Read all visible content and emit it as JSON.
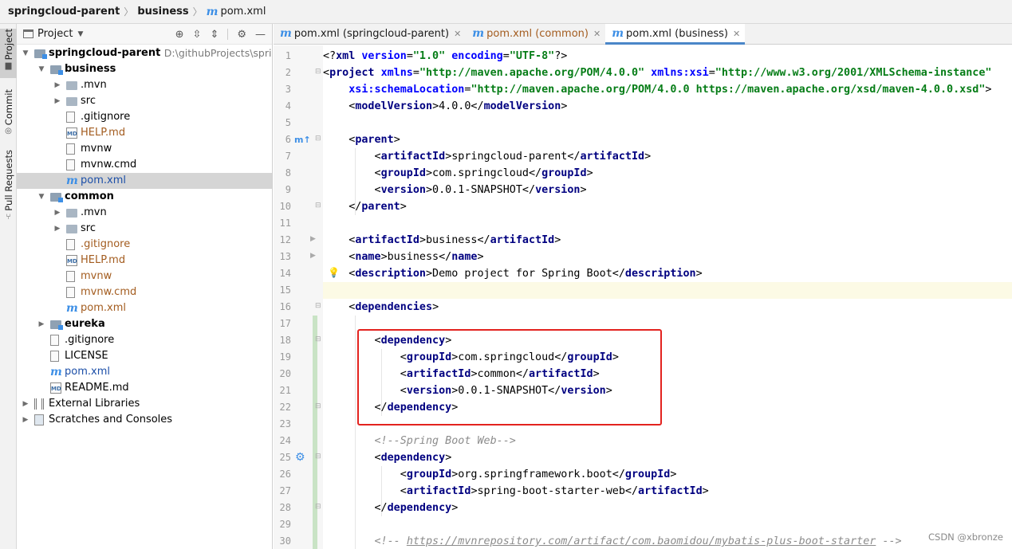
{
  "breadcrumb": {
    "items": [
      "springcloud-parent",
      "business"
    ],
    "file": "pom.xml"
  },
  "tool_strip": {
    "items": [
      "Project",
      "Commit",
      "Pull Requests"
    ]
  },
  "project_panel": {
    "title": "Project",
    "tree": [
      {
        "label": "springcloud-parent",
        "path": "D:\\githubProjects\\springclo",
        "depth": 0,
        "expand": "open",
        "icon": "module-folder",
        "style": "bold"
      },
      {
        "label": "business",
        "depth": 1,
        "expand": "open",
        "icon": "module-folder",
        "style": "bold"
      },
      {
        "label": ".mvn",
        "depth": 2,
        "expand": "closed",
        "icon": "folder"
      },
      {
        "label": "src",
        "depth": 2,
        "expand": "closed",
        "icon": "folder"
      },
      {
        "label": ".gitignore",
        "depth": 2,
        "icon": "ignore-file"
      },
      {
        "label": "HELP.md",
        "depth": 2,
        "icon": "md-file",
        "style": "brown"
      },
      {
        "label": "mvnw",
        "depth": 2,
        "icon": "file"
      },
      {
        "label": "mvnw.cmd",
        "depth": 2,
        "icon": "file"
      },
      {
        "label": "pom.xml",
        "depth": 2,
        "icon": "maven-file",
        "style": "blue",
        "selected": true
      },
      {
        "label": "common",
        "depth": 1,
        "expand": "open",
        "icon": "module-folder",
        "style": "bold"
      },
      {
        "label": ".mvn",
        "depth": 2,
        "expand": "closed",
        "icon": "folder"
      },
      {
        "label": "src",
        "depth": 2,
        "expand": "closed",
        "icon": "folder"
      },
      {
        "label": ".gitignore",
        "depth": 2,
        "icon": "ignore-file",
        "style": "brown"
      },
      {
        "label": "HELP.md",
        "depth": 2,
        "icon": "md-file",
        "style": "brown"
      },
      {
        "label": "mvnw",
        "depth": 2,
        "icon": "file",
        "style": "brown"
      },
      {
        "label": "mvnw.cmd",
        "depth": 2,
        "icon": "file",
        "style": "brown"
      },
      {
        "label": "pom.xml",
        "depth": 2,
        "icon": "maven-file",
        "style": "brown"
      },
      {
        "label": "eureka",
        "depth": 1,
        "expand": "closed",
        "icon": "module-folder",
        "style": "bold"
      },
      {
        "label": ".gitignore",
        "depth": 1,
        "icon": "ignore-file"
      },
      {
        "label": "LICENSE",
        "depth": 1,
        "icon": "file"
      },
      {
        "label": "pom.xml",
        "depth": 1,
        "icon": "maven-file",
        "style": "blue"
      },
      {
        "label": "README.md",
        "depth": 1,
        "icon": "md-file"
      },
      {
        "label": "External Libraries",
        "depth": 0,
        "expand": "closed",
        "icon": "library"
      },
      {
        "label": "Scratches and Consoles",
        "depth": 0,
        "expand": "closed",
        "icon": "scratches"
      }
    ]
  },
  "editor": {
    "tabs": [
      {
        "label": "pom.xml (springcloud-parent)",
        "active": false,
        "style": "normal"
      },
      {
        "label": "pom.xml (common)",
        "active": false,
        "style": "brown"
      },
      {
        "label": "pom.xml (business)",
        "active": true,
        "style": "normal"
      }
    ],
    "current_line": 15,
    "lines": [
      {
        "n": 1,
        "t": [
          [
            "x",
            "<?"
          ],
          [
            "tg",
            "xml "
          ],
          [
            "an",
            "version"
          ],
          [
            "x",
            "="
          ],
          [
            "av",
            "\"1.0\""
          ],
          [
            "x",
            " "
          ],
          [
            "an",
            "encoding"
          ],
          [
            "x",
            "="
          ],
          [
            "av",
            "\"UTF-8\""
          ],
          [
            "x",
            "?>"
          ]
        ]
      },
      {
        "n": 2,
        "t": [
          [
            "x",
            "<"
          ],
          [
            "tg",
            "project "
          ],
          [
            "an",
            "xmlns"
          ],
          [
            "x",
            "="
          ],
          [
            "av",
            "\"http://maven.apache.org/POM/4.0.0\""
          ],
          [
            "x",
            " "
          ],
          [
            "an",
            "xmlns:xsi"
          ],
          [
            "x",
            "="
          ],
          [
            "av",
            "\"http://www.w3.org/2001/XMLSchema-instance\""
          ]
        ]
      },
      {
        "n": 3,
        "t": [
          [
            "x",
            "    "
          ],
          [
            "an",
            "xsi:schemaLocation"
          ],
          [
            "x",
            "="
          ],
          [
            "av",
            "\"http://maven.apache.org/POM/4.0.0 https://maven.apache.org/xsd/maven-4.0.0.xsd\""
          ],
          [
            "x",
            ">"
          ]
        ]
      },
      {
        "n": 4,
        "t": [
          [
            "x",
            "    <"
          ],
          [
            "tg",
            "modelVersion"
          ],
          [
            "x",
            ">4.0.0</"
          ],
          [
            "tg",
            "modelVersion"
          ],
          [
            "x",
            ">"
          ]
        ]
      },
      {
        "n": 5,
        "t": []
      },
      {
        "n": 6,
        "t": [
          [
            "x",
            "    <"
          ],
          [
            "tg",
            "parent"
          ],
          [
            "x",
            ">"
          ]
        ]
      },
      {
        "n": 7,
        "t": [
          [
            "x",
            "        <"
          ],
          [
            "tg",
            "artifactId"
          ],
          [
            "x",
            ">springcloud-parent</"
          ],
          [
            "tg",
            "artifactId"
          ],
          [
            "x",
            ">"
          ]
        ]
      },
      {
        "n": 8,
        "t": [
          [
            "x",
            "        <"
          ],
          [
            "tg",
            "groupId"
          ],
          [
            "x",
            ">com.springcloud</"
          ],
          [
            "tg",
            "groupId"
          ],
          [
            "x",
            ">"
          ]
        ]
      },
      {
        "n": 9,
        "t": [
          [
            "x",
            "        <"
          ],
          [
            "tg",
            "version"
          ],
          [
            "x",
            ">0.0.1-SNAPSHOT</"
          ],
          [
            "tg",
            "version"
          ],
          [
            "x",
            ">"
          ]
        ]
      },
      {
        "n": 10,
        "t": [
          [
            "x",
            "    </"
          ],
          [
            "tg",
            "parent"
          ],
          [
            "x",
            ">"
          ]
        ]
      },
      {
        "n": 11,
        "t": []
      },
      {
        "n": 12,
        "t": [
          [
            "x",
            "    <"
          ],
          [
            "tg",
            "artifactId"
          ],
          [
            "x",
            ">business</"
          ],
          [
            "tg",
            "artifactId"
          ],
          [
            "x",
            ">"
          ]
        ]
      },
      {
        "n": 13,
        "t": [
          [
            "x",
            "    <"
          ],
          [
            "tg",
            "name"
          ],
          [
            "x",
            ">business</"
          ],
          [
            "tg",
            "name"
          ],
          [
            "x",
            ">"
          ]
        ]
      },
      {
        "n": 14,
        "t": [
          [
            "x",
            "    <"
          ],
          [
            "tg",
            "description"
          ],
          [
            "x",
            ">Demo project for Spring Boot</"
          ],
          [
            "tg",
            "description"
          ],
          [
            "x",
            ">"
          ]
        ]
      },
      {
        "n": 15,
        "t": []
      },
      {
        "n": 16,
        "t": [
          [
            "x",
            "    <"
          ],
          [
            "tg",
            "dependencies"
          ],
          [
            "x",
            ">"
          ]
        ]
      },
      {
        "n": 17,
        "t": []
      },
      {
        "n": 18,
        "t": [
          [
            "x",
            "        <"
          ],
          [
            "tg",
            "dependency"
          ],
          [
            "x",
            ">"
          ]
        ]
      },
      {
        "n": 19,
        "t": [
          [
            "x",
            "            <"
          ],
          [
            "tg",
            "groupId"
          ],
          [
            "x",
            ">com.springcloud</"
          ],
          [
            "tg",
            "groupId"
          ],
          [
            "x",
            ">"
          ]
        ]
      },
      {
        "n": 20,
        "t": [
          [
            "x",
            "            <"
          ],
          [
            "tg",
            "artifactId"
          ],
          [
            "x",
            ">common</"
          ],
          [
            "tg",
            "artifactId"
          ],
          [
            "x",
            ">"
          ]
        ]
      },
      {
        "n": 21,
        "t": [
          [
            "x",
            "            <"
          ],
          [
            "tg",
            "version"
          ],
          [
            "x",
            ">0.0.1-SNAPSHOT</"
          ],
          [
            "tg",
            "version"
          ],
          [
            "x",
            ">"
          ]
        ]
      },
      {
        "n": 22,
        "t": [
          [
            "x",
            "        </"
          ],
          [
            "tg",
            "dependency"
          ],
          [
            "x",
            ">"
          ]
        ]
      },
      {
        "n": 23,
        "t": []
      },
      {
        "n": 24,
        "t": [
          [
            "x",
            "        "
          ],
          [
            "cm",
            "<!--Spring Boot Web-->"
          ]
        ]
      },
      {
        "n": 25,
        "t": [
          [
            "x",
            "        <"
          ],
          [
            "tg",
            "dependency"
          ],
          [
            "x",
            ">"
          ]
        ]
      },
      {
        "n": 26,
        "t": [
          [
            "x",
            "            <"
          ],
          [
            "tg",
            "groupId"
          ],
          [
            "x",
            ">org.springframework.boot</"
          ],
          [
            "tg",
            "groupId"
          ],
          [
            "x",
            ">"
          ]
        ]
      },
      {
        "n": 27,
        "t": [
          [
            "x",
            "            <"
          ],
          [
            "tg",
            "artifactId"
          ],
          [
            "x",
            ">spring-boot-starter-web</"
          ],
          [
            "tg",
            "artifactId"
          ],
          [
            "x",
            ">"
          ]
        ]
      },
      {
        "n": 28,
        "t": [
          [
            "x",
            "        </"
          ],
          [
            "tg",
            "dependency"
          ],
          [
            "x",
            ">"
          ]
        ]
      },
      {
        "n": 29,
        "t": []
      },
      {
        "n": 30,
        "t": [
          [
            "x",
            "        "
          ],
          [
            "cm",
            "<!-- "
          ],
          [
            "url",
            "https://mvnrepository.com/artifact/com.baomidou/mybatis-plus-boot-starter"
          ],
          [
            "cm",
            " -->"
          ]
        ]
      }
    ]
  },
  "watermark": "CSDN @xbronze",
  "colors": {
    "highlight_box": "#e3231f",
    "tag": "#000080",
    "attr_name": "#0000ff",
    "attr_value": "#067d17",
    "selection": "#d5d5d5",
    "active_tab_underline": "#4a86c8"
  }
}
